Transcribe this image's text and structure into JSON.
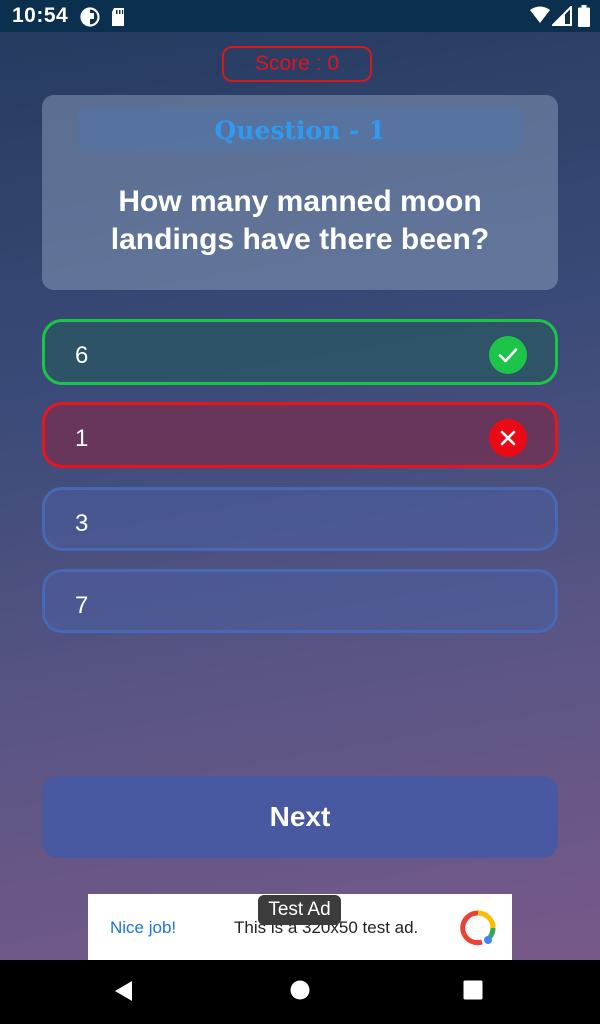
{
  "status_bar": {
    "time": "10:54",
    "icons": [
      "cast-icon",
      "sd-card-icon",
      "wifi-icon",
      "signal-icon",
      "battery-icon"
    ]
  },
  "score": {
    "label": "Score : 0",
    "color": "#e0141e"
  },
  "question": {
    "header": "Question - 1",
    "text": "How many manned moon landings have there been?"
  },
  "options": [
    {
      "label": "6",
      "state": "correct",
      "icon": "check-icon",
      "color": "#1cc44a"
    },
    {
      "label": "1",
      "state": "wrong",
      "icon": "close-icon",
      "color": "#e81520"
    },
    {
      "label": "3",
      "state": "neutral"
    },
    {
      "label": "7",
      "state": "neutral"
    }
  ],
  "next_button": {
    "label": "Next"
  },
  "ad": {
    "tag": "Test Ad",
    "cta": "Nice job!",
    "text": "This is a 320x50 test ad."
  },
  "nav_bar": {
    "buttons": [
      "back-icon",
      "home-icon",
      "recents-icon"
    ]
  }
}
